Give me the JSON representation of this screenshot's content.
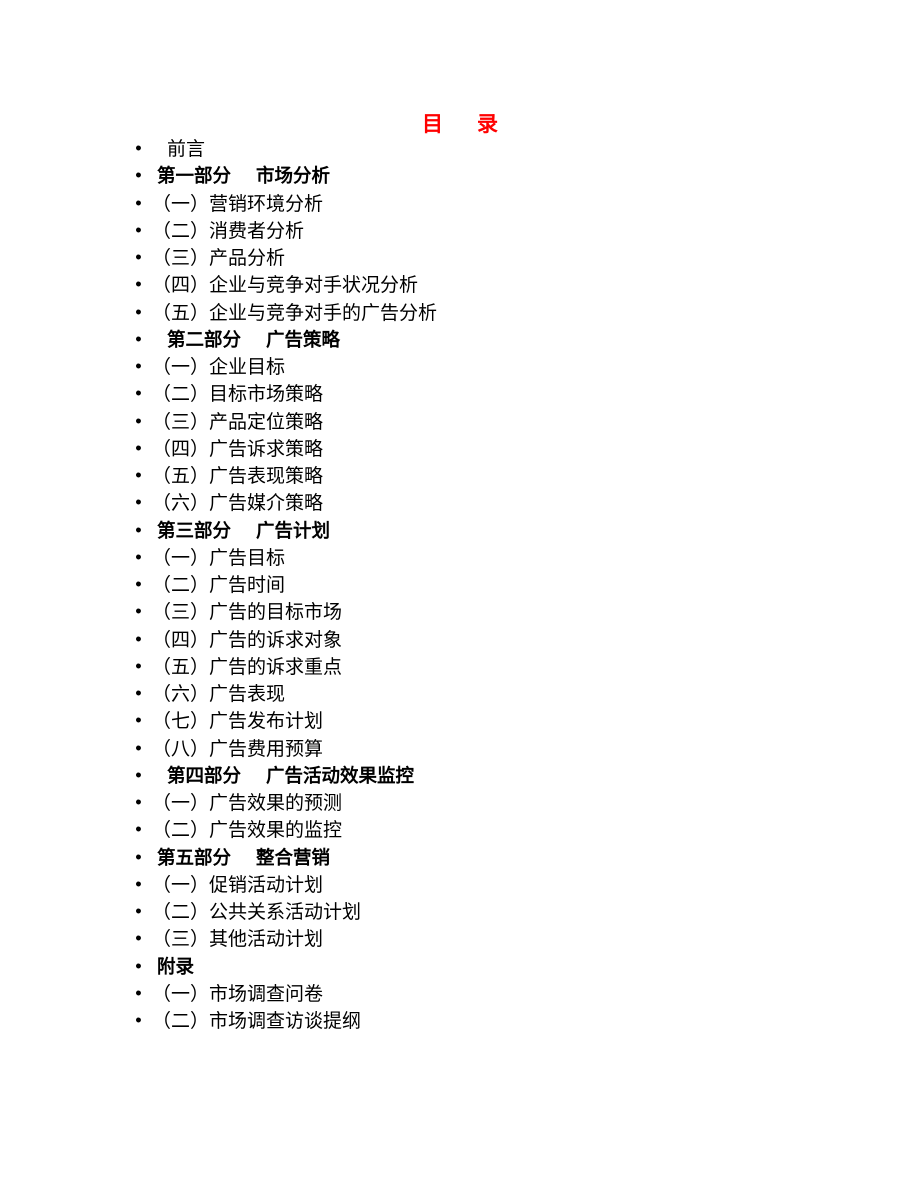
{
  "title": {
    "char1": "目",
    "char2": "录",
    "color": "#ff0000"
  },
  "bullet": "•",
  "entries": [
    {
      "text": "前言",
      "style": "indent"
    },
    {
      "text": "第一部分　 市场分析",
      "style": "bold"
    },
    {
      "text": "（一）营销环境分析",
      "style": "item"
    },
    {
      "text": "（二）消费者分析",
      "style": "item"
    },
    {
      "text": "（三）产品分析",
      "style": "item"
    },
    {
      "text": "（四）企业与竞争对手状况分析",
      "style": "item"
    },
    {
      "text": "（五）企业与竞争对手的广告分析",
      "style": "item"
    },
    {
      "text": "第二部分　 广告策略",
      "style": "bold indent"
    },
    {
      "text": "（一）企业目标",
      "style": "item"
    },
    {
      "text": "（二）目标市场策略",
      "style": "item"
    },
    {
      "text": "（三）产品定位策略",
      "style": "item"
    },
    {
      "text": "（四）广告诉求策略",
      "style": "item"
    },
    {
      "text": "（五）广告表现策略",
      "style": "item"
    },
    {
      "text": "（六）广告媒介策略",
      "style": "item"
    },
    {
      "text": "第三部分　 广告计划",
      "style": "bold"
    },
    {
      "text": "（一）广告目标",
      "style": "item"
    },
    {
      "text": "（二）广告时间",
      "style": "item"
    },
    {
      "text": "（三）广告的目标市场",
      "style": "item"
    },
    {
      "text": "（四）广告的诉求对象",
      "style": "item"
    },
    {
      "text": "（五）广告的诉求重点",
      "style": "item"
    },
    {
      "text": "（六）广告表现",
      "style": "item"
    },
    {
      "text": "（七）广告发布计划",
      "style": "item"
    },
    {
      "text": "（八）广告费用预算",
      "style": "item"
    },
    {
      "text": "第四部分　 广告活动效果监控",
      "style": "bold indent"
    },
    {
      "text": "（一）广告效果的预测",
      "style": "item"
    },
    {
      "text": "（二）广告效果的监控",
      "style": "item"
    },
    {
      "text": "第五部分　 整合营销",
      "style": "bold"
    },
    {
      "text": "（一）促销活动计划",
      "style": "item"
    },
    {
      "text": "（二）公共关系活动计划",
      "style": "item"
    },
    {
      "text": "（三）其他活动计划",
      "style": "item"
    },
    {
      "text": "附录",
      "style": "bold"
    },
    {
      "text": "（一）市场调查问卷",
      "style": "item"
    },
    {
      "text": "（二）市场调查访谈提纲",
      "style": "item"
    }
  ]
}
